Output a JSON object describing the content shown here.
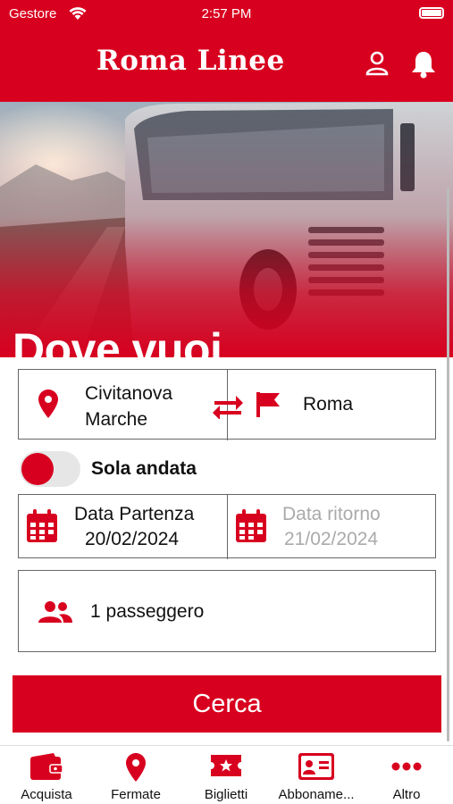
{
  "status_bar": {
    "carrier": "Gestore",
    "time": "2:57 PM"
  },
  "header": {
    "brand": "Roma Linee"
  },
  "hero": {
    "title": "Dove vuoi andare?"
  },
  "route": {
    "from": "Civitanova Marche",
    "to": "Roma"
  },
  "trip_type": {
    "label": "Sola andata"
  },
  "dates": {
    "departure_label": "Data Partenza",
    "departure_value": "20/02/2024",
    "return_label": "Data ritorno",
    "return_value": "21/02/2024"
  },
  "passengers": {
    "label": "1 passeggero"
  },
  "search": {
    "button_label": "Cerca"
  },
  "tabbar": {
    "items": [
      {
        "label": "Acquista",
        "icon": "wallet-icon"
      },
      {
        "label": "Fermate",
        "icon": "map-pin-icon"
      },
      {
        "label": "Biglietti",
        "icon": "ticket-icon"
      },
      {
        "label": "Abboname...",
        "icon": "id-card-icon"
      },
      {
        "label": "Altro",
        "icon": "more-icon"
      }
    ]
  },
  "colors": {
    "brand_red": "#d8001f",
    "text": "#111111",
    "muted": "#aaaaaa"
  }
}
